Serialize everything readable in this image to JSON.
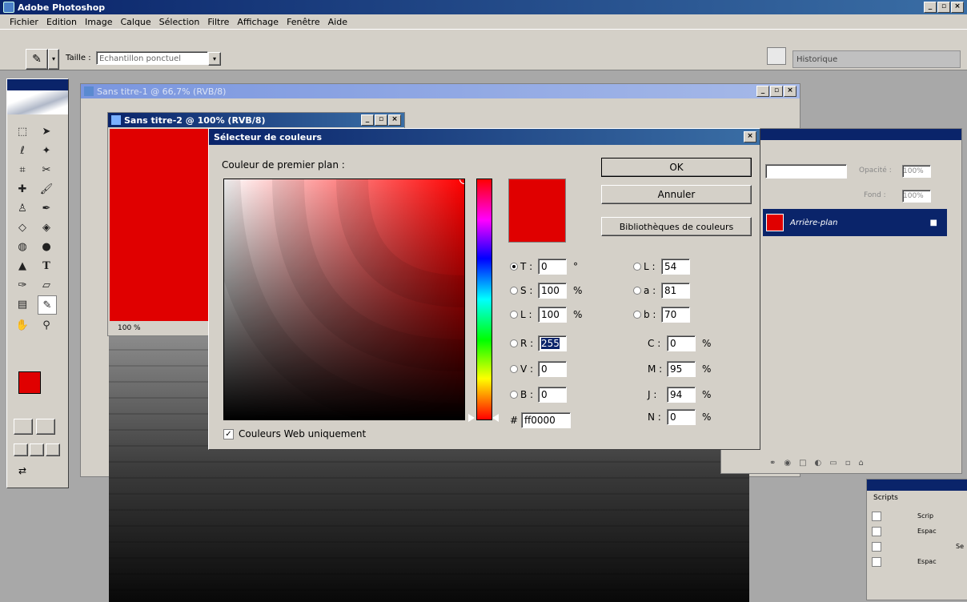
{
  "app": {
    "title": "Adobe Photoshop",
    "icon": "photoshop-icon"
  },
  "menu": [
    "Fichier",
    "Edition",
    "Image",
    "Calque",
    "Sélection",
    "Filtre",
    "Affichage",
    "Fenêtre",
    "Aide"
  ],
  "options_bar": {
    "size_label": "Taille :",
    "size_value": "Echantillon ponctuel",
    "history_tab": "Historique"
  },
  "doc1": {
    "title": "Sans titre-1 @ 66,7% (RVB/8)"
  },
  "doc2": {
    "title": "Sans titre-2 @ 100% (RVB/8)",
    "zoom": "100 %"
  },
  "dialog": {
    "title": "Sélecteur de couleurs",
    "label": "Couleur de premier plan :",
    "ok": "OK",
    "cancel": "Annuler",
    "libraries": "Bibliothèques de couleurs",
    "web_only": "Couleurs Web uniquement",
    "color": "#e00000",
    "fields": {
      "T": {
        "label": "T :",
        "value": "0",
        "unit": "°"
      },
      "S": {
        "label": "S :",
        "value": "100",
        "unit": "%"
      },
      "L1": {
        "label": "L :",
        "value": "100",
        "unit": "%"
      },
      "R": {
        "label": "R :",
        "value": "255"
      },
      "V": {
        "label": "V :",
        "value": "0"
      },
      "B": {
        "label": "B :",
        "value": "0"
      },
      "Lab_L": {
        "label": "L :",
        "value": "54"
      },
      "Lab_a": {
        "label": "a :",
        "value": "81"
      },
      "Lab_b": {
        "label": "b :",
        "value": "70"
      },
      "C": {
        "label": "C :",
        "value": "0",
        "unit": "%"
      },
      "M": {
        "label": "M :",
        "value": "95",
        "unit": "%"
      },
      "J": {
        "label": "J :",
        "value": "94",
        "unit": "%"
      },
      "N": {
        "label": "N :",
        "value": "0",
        "unit": "%"
      },
      "hex": {
        "label": "#",
        "value": "ff0000"
      }
    }
  },
  "layers": {
    "opacity_label": "Opacité :",
    "opacity_value": "100%",
    "fill_label": "Fond :",
    "fill_value": "100%",
    "layer_name": "Arrière-plan"
  },
  "scripts": {
    "tab": "Scripts",
    "rows": [
      "Scrip",
      "Espac",
      "Se",
      "Espac"
    ]
  },
  "colors": {
    "foreground": "#e00000",
    "background": "#000000"
  }
}
